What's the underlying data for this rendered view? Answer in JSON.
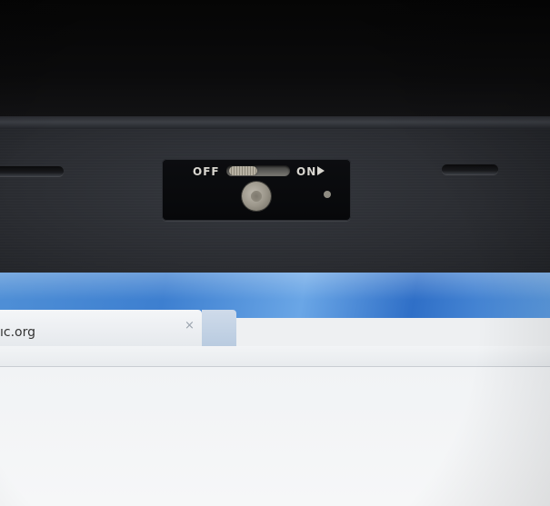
{
  "webcam_shutter": {
    "off_label": "OFF",
    "on_label": "ON",
    "arrow_icon": "triangle-right-icon",
    "state": "off"
  },
  "browser": {
    "tab_title": "ıc.org",
    "tab_close_glyph": "×"
  },
  "colors": {
    "bezel": "#2a2c31",
    "shutter_panel": "#0a0b0e",
    "label": "#d8d6cf",
    "titlebar": "#3d7fd0"
  }
}
